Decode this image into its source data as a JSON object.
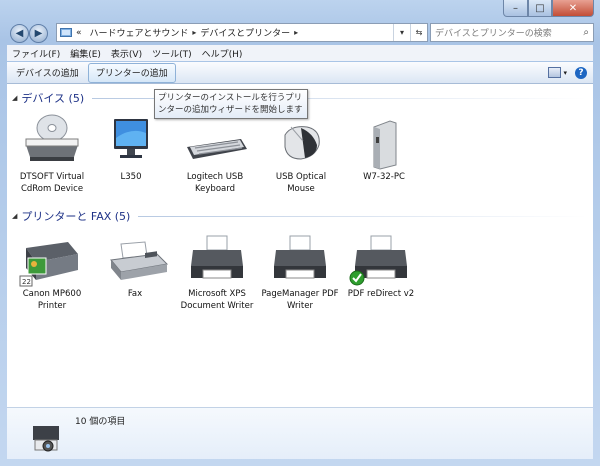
{
  "address": {
    "overflow": "«",
    "crumbs": [
      "ハードウェアとサウンド",
      "デバイスとプリンター"
    ]
  },
  "search": {
    "placeholder": "デバイスとプリンターの検索"
  },
  "menu": [
    "ファイル(F)",
    "編集(E)",
    "表示(V)",
    "ツール(T)",
    "ヘルプ(H)"
  ],
  "commands": {
    "add_device": "デバイスの追加",
    "add_printer": "プリンターの追加"
  },
  "tooltip": "プリンターのインストールを行うプリンターの追加ウィザードを開始します",
  "groups": {
    "devices": {
      "label": "デバイス (5)",
      "items": [
        "DTSOFT Virtual CdRom Device",
        "L350",
        "Logitech USB Keyboard",
        "USB Optical Mouse",
        "W7-32-PC"
      ]
    },
    "printers": {
      "label": "プリンターと FAX (5)",
      "items": [
        "Canon MP600 Printer",
        "Fax",
        "Microsoft XPS Document Writer",
        "PageManager PDF Writer",
        "PDF reDirect v2"
      ]
    }
  },
  "details": {
    "count": "10 個の項目"
  },
  "icons": [
    "back-icon",
    "forward-icon",
    "folder-icon",
    "refresh-icon",
    "search-icon",
    "view-icon",
    "help-icon",
    "cdrom-icon",
    "monitor-icon",
    "keyboard-icon",
    "mouse-icon",
    "pc-icon",
    "mfp-printer-icon",
    "fax-icon",
    "printer-icon",
    "default-check-icon",
    "camera-printer-icon"
  ]
}
